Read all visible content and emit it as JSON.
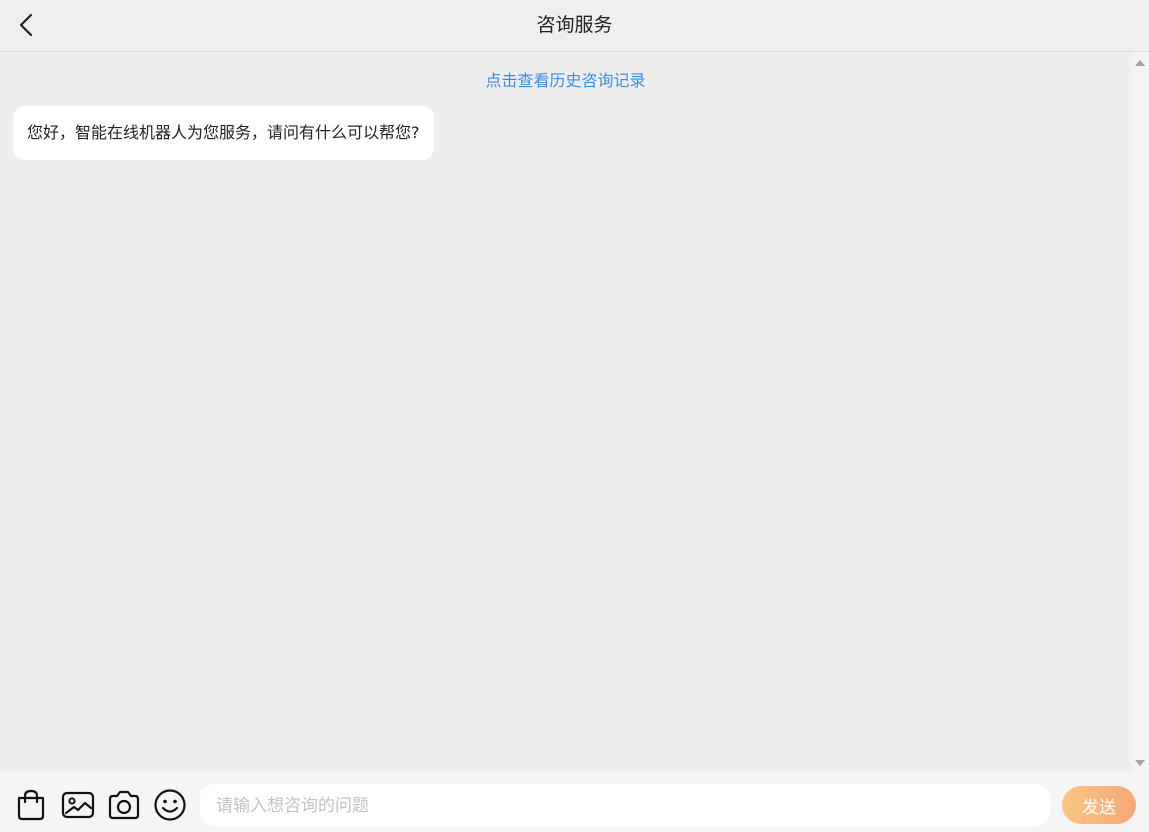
{
  "header": {
    "title": "咨询服务",
    "back_icon": "chevron-left-icon"
  },
  "chat": {
    "history_link": "点击查看历史咨询记录",
    "messages": [
      {
        "sender": "bot",
        "text": "您好，智能在线机器人为您服务，请问有什么可以帮您?"
      }
    ]
  },
  "composer": {
    "tools": [
      "shopping-bag-icon",
      "image-icon",
      "camera-icon",
      "emoji-icon"
    ],
    "input_placeholder": "请输入想咨询的问题",
    "input_value": "",
    "send_label": "发送"
  },
  "colors": {
    "accent_link": "#3a8ee6",
    "send_gradient_start": "#f9c585",
    "send_gradient_end": "#f6a877"
  }
}
